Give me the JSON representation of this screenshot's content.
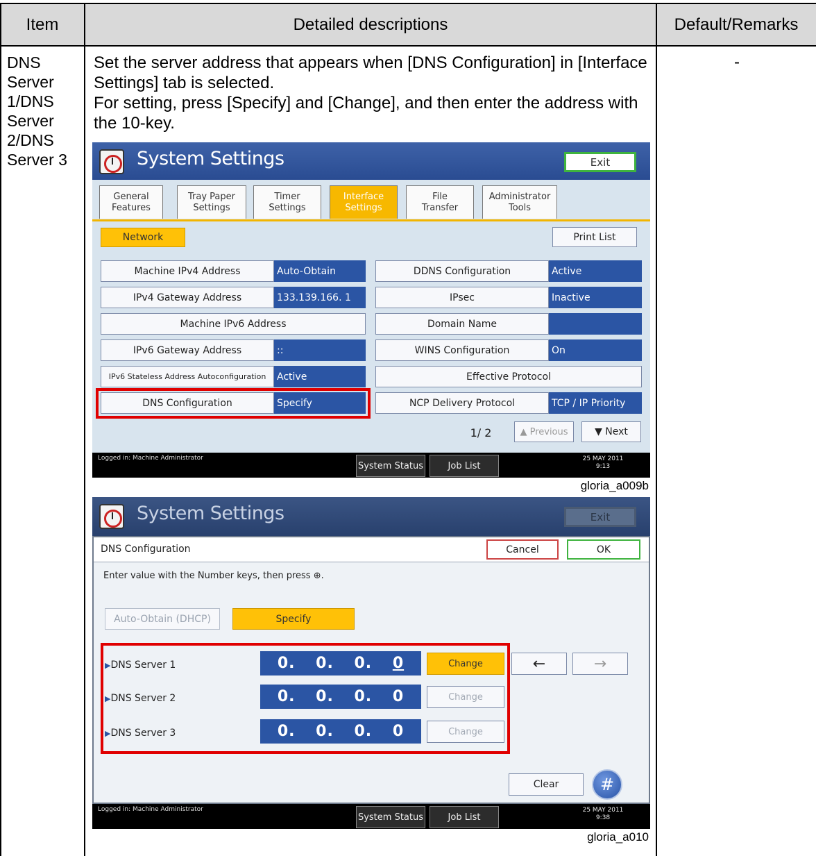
{
  "table": {
    "headers": {
      "item": "Item",
      "descriptions": "Detailed descriptions",
      "remarks": "Default/Remarks"
    },
    "row": {
      "item": "DNS Server 1/DNS Server 2/DNS Server 3",
      "description_line1": "Set the server address that appears when [DNS Configuration] in [Interface Settings] tab is selected.",
      "description_line2": "For setting, press [Specify] and [Change], and then enter the address with the 10-key.",
      "remarks": "-"
    }
  },
  "screen1": {
    "title": "System Settings",
    "exit": "Exit",
    "tabs": [
      {
        "line1": "General",
        "line2": "Features"
      },
      {
        "line1": "Tray Paper",
        "line2": "Settings"
      },
      {
        "line1": "Timer",
        "line2": "Settings"
      },
      {
        "line1": "Interface",
        "line2": "Settings"
      },
      {
        "line1": "File",
        "line2": "Transfer"
      },
      {
        "line1": "Administrator",
        "line2": "Tools"
      }
    ],
    "network": "Network",
    "print_list": "Print List",
    "left_items": [
      {
        "label": "Machine IPv4 Address",
        "value": "Auto-Obtain"
      },
      {
        "label": "IPv4 Gateway Address",
        "value": "133.139.166.  1"
      },
      {
        "label": "Machine IPv6 Address",
        "value": ""
      },
      {
        "label": "IPv6 Gateway Address",
        "value": "::"
      },
      {
        "label": "IPv6 Stateless Address Autoconfiguration",
        "value": "Active"
      },
      {
        "label": "DNS Configuration",
        "value": "Specify"
      }
    ],
    "right_items": [
      {
        "label": "DDNS Configuration",
        "value": "Active"
      },
      {
        "label": "IPsec",
        "value": "Inactive"
      },
      {
        "label": "Domain Name",
        "value": ""
      },
      {
        "label": "WINS Configuration",
        "value": "On"
      },
      {
        "label": "Effective Protocol",
        "value": ""
      },
      {
        "label": "NCP Delivery Protocol",
        "value": "TCP / IP Priority"
      }
    ],
    "page": "1∕ 2",
    "previous": "▲ Previous",
    "next": "▼ Next",
    "logged_in": "Logged in: Machine Administrator",
    "system_status": "System Status",
    "job_list": "Job List",
    "date": "25 MAY  2011",
    "time": "9:13",
    "caption": "gloria_a009b"
  },
  "screen2": {
    "title": "System Settings",
    "exit": "Exit",
    "dialog_title": "DNS Configuration",
    "cancel": "Cancel",
    "ok": "OK",
    "instruction": "Enter value with the Number keys, then press ⊕.",
    "auto_obtain": "Auto-Obtain (DHCP)",
    "specify": "Specify",
    "servers": [
      {
        "label": "DNS Server 1",
        "value": [
          "0.",
          "0.",
          "0.",
          "0"
        ],
        "change": "Change"
      },
      {
        "label": "DNS Server 2",
        "value": [
          "0.",
          "0.",
          "0.",
          "0"
        ],
        "change": "Change"
      },
      {
        "label": "DNS Server 3",
        "value": [
          "0.",
          "0.",
          "0.",
          "0"
        ],
        "change": "Change"
      }
    ],
    "left_arrow": "←",
    "right_arrow": "→",
    "clear": "Clear",
    "hash": "#",
    "logged_in": "Logged in: Machine Administrator",
    "system_status": "System Status",
    "job_list": "Job List",
    "date": "25 MAY  2011",
    "time": "9:38",
    "caption": "gloria_a010"
  }
}
